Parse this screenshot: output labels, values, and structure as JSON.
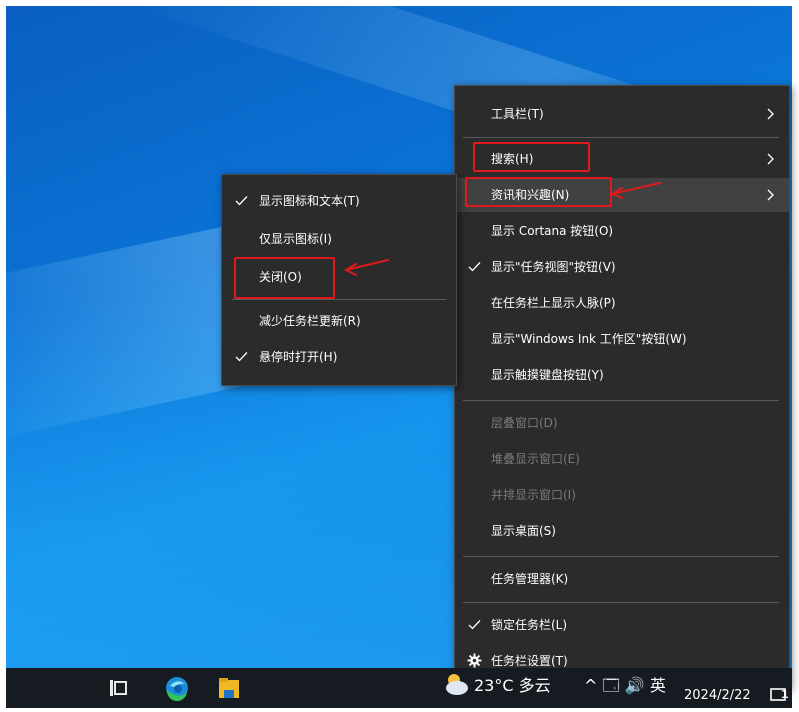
{
  "main_menu": {
    "items": [
      {
        "label": "工具栏(T)",
        "submenu": true
      },
      {
        "label": "搜索(H)",
        "submenu": true
      },
      {
        "label": "资讯和兴趣(N)",
        "submenu": true,
        "highlighted": true
      },
      {
        "label": "显示 Cortana 按钮(O)"
      },
      {
        "label": "显示\"任务视图\"按钮(V)",
        "checked": true
      },
      {
        "label": "在任务栏上显示人脉(P)"
      },
      {
        "label": "显示\"Windows Ink 工作区\"按钮(W)"
      },
      {
        "label": "显示触摸键盘按钮(Y)"
      },
      {
        "label": "层叠窗口(D)",
        "disabled": true
      },
      {
        "label": "堆叠显示窗口(E)",
        "disabled": true
      },
      {
        "label": "并排显示窗口(I)",
        "disabled": true
      },
      {
        "label": "显示桌面(S)"
      },
      {
        "label": "任务管理器(K)"
      },
      {
        "label": "锁定任务栏(L)",
        "checked": true
      },
      {
        "label": "任务栏设置(T)",
        "icon": "gear-icon"
      }
    ]
  },
  "sub_menu": {
    "items": [
      {
        "label": "显示图标和文本(T)",
        "checked": true
      },
      {
        "label": "仅显示图标(I)"
      },
      {
        "label": "关闭(O)"
      },
      {
        "label": "减少任务栏更新(R)"
      },
      {
        "label": "悬停时打开(H)",
        "checked": true
      }
    ]
  },
  "taskbar": {
    "weather": "23°C 多云",
    "tray_text": "^ 🗔 🔊 英",
    "date": "2024/2/22",
    "notification_count": "1",
    "icons": [
      "task-view-icon",
      "edge-icon",
      "file-explorer-icon",
      "weather-icon"
    ]
  },
  "colors": {
    "menu_bg": "#2b2b2b",
    "highlight": "#414141",
    "annotation": "#e01a1a",
    "taskbar": "#161b22"
  }
}
